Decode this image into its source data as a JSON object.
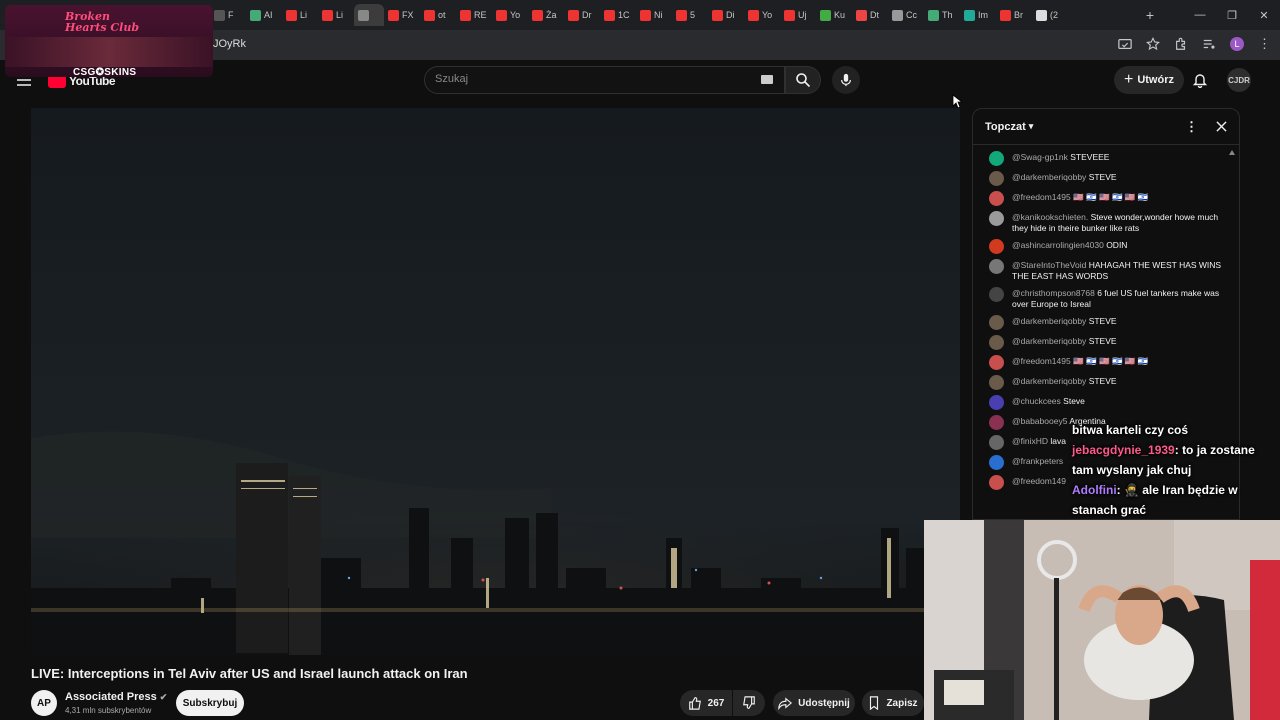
{
  "browser": {
    "tabs": [
      {
        "label": "F",
        "color": "#555"
      },
      {
        "label": "AI",
        "color": "#4a7"
      },
      {
        "label": "Li",
        "color": "#e33"
      },
      {
        "label": "Li",
        "color": "#e33"
      },
      {
        "label": "",
        "color": "#888",
        "active": true
      },
      {
        "label": "FX",
        "color": "#e33"
      },
      {
        "label": "ot",
        "color": "#e33"
      },
      {
        "label": "RE",
        "color": "#e33"
      },
      {
        "label": "Yo",
        "color": "#e33"
      },
      {
        "label": "Ża",
        "color": "#e33"
      },
      {
        "label": "Dr",
        "color": "#e33"
      },
      {
        "label": "1C",
        "color": "#e33"
      },
      {
        "label": "Ni",
        "color": "#e33"
      },
      {
        "label": "5",
        "color": "#e33"
      },
      {
        "label": "Di",
        "color": "#e33"
      },
      {
        "label": "Yo",
        "color": "#e33"
      },
      {
        "label": "Uj",
        "color": "#e33"
      },
      {
        "label": "Ku",
        "color": "#4a4"
      },
      {
        "label": "Dt",
        "color": "#e44"
      },
      {
        "label": "Cc",
        "color": "#999"
      },
      {
        "label": "Th",
        "color": "#4a7"
      },
      {
        "label": "Im",
        "color": "#2a9"
      },
      {
        "label": "Br",
        "color": "#e33"
      },
      {
        "label": "(2",
        "color": "#ddd"
      }
    ],
    "url": "JOyRk",
    "new_tab": "+",
    "minimize": "—",
    "restore": "❐",
    "close": "✕",
    "profile_initial": "L"
  },
  "stream_logo": {
    "title": "Broken Hearts Club",
    "badge": "CSG✪SKINS"
  },
  "youtube": {
    "logo": "YouTube",
    "search_placeholder": "Szukaj",
    "create_label": "Utwórz",
    "account_initials": "CJDR"
  },
  "video": {
    "title": "LIVE: Interceptions in Tel Aviv after US and Israel launch attack on Iran",
    "channel": "Associated Press",
    "channel_initials": "AP",
    "subscribers": "4,31 mln subskrybentów",
    "subscribe": "Subskrybuj",
    "likes": "267",
    "share": "Udostępnij",
    "save": "Zapisz"
  },
  "chat": {
    "mode": "Topczat",
    "messages": [
      {
        "author": "@Swag-gp1nk",
        "text": "STEVEEE",
        "color": "#12a87a"
      },
      {
        "author": "@darkemberiqobby",
        "text": "STEVE",
        "color": "#6a5a4a"
      },
      {
        "author": "@freedom1495",
        "text": "🇺🇸 🇮🇱 🇺🇸 🇮🇱 🇺🇸 🇮🇱",
        "color": "#c94f4f"
      },
      {
        "author": "@kanikookschieten.",
        "text": "Steve wonder,wonder howe much they hide in theire bunker like rats",
        "color": "#9a9a9a"
      },
      {
        "author": "@ashincarrolingien4030",
        "text": "ODIN",
        "color": "#d23a1f"
      },
      {
        "author": "@StareIntoTheVoid",
        "text": "HAHAGAH THE WEST HAS WINS THE EAST HAS WORDS",
        "color": "#777"
      },
      {
        "author": "@christhompson8768",
        "text": "6 fuel US fuel tankers make was over Europe to Isreal",
        "color": "#444"
      },
      {
        "author": "@darkemberiqobby",
        "text": "STEVE",
        "color": "#6a5a4a"
      },
      {
        "author": "@darkemberiqobby",
        "text": "STEVE",
        "color": "#6a5a4a"
      },
      {
        "author": "@freedom1495",
        "text": "🇺🇸 🇮🇱 🇺🇸 🇮🇱 🇺🇸 🇮🇱",
        "color": "#c94f4f"
      },
      {
        "author": "@darkemberiqobby",
        "text": "STEVE",
        "color": "#6a5a4a"
      },
      {
        "author": "@chuckcees",
        "text": "Steve",
        "color": "#4a3fb0"
      },
      {
        "author": "@bababooey5",
        "text": "Argentina",
        "color": "#8a3050"
      },
      {
        "author": "@finixHD",
        "text": "lava",
        "color": "#666"
      },
      {
        "author": "@frankpeters",
        "text": "",
        "color": "#2a6fd0"
      },
      {
        "author": "@freedom149",
        "text": "",
        "color": "#c94f4f"
      }
    ]
  },
  "stream_overlay": [
    {
      "user": "",
      "text": "bitwa karteli czy coś",
      "user_color": "#fff"
    },
    {
      "user": "jebacgdynie_1939",
      "text": ": to ja zostane tam wyslany jak chuj",
      "user_color": "#ff5a8a"
    },
    {
      "user": "Adolfini",
      "text": ": 🥷 ale Iran będzie w stanach grać",
      "user_color": "#b07cff"
    }
  ]
}
